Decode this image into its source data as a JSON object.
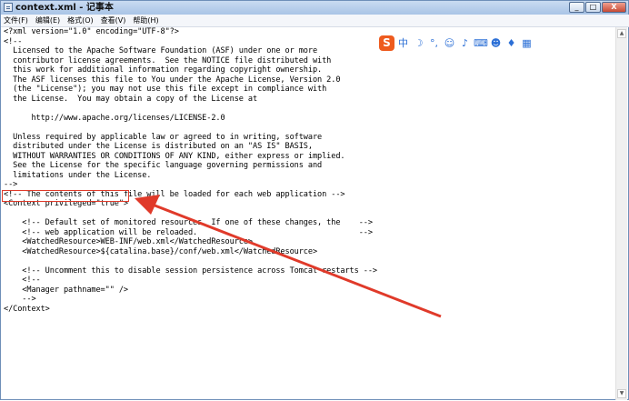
{
  "window": {
    "title": "context.xml - 记事本",
    "controls": {
      "minimize": "_",
      "maximize": "□",
      "close": "X"
    }
  },
  "menu": [
    "文件(F)",
    "编辑(E)",
    "格式(O)",
    "查看(V)",
    "帮助(H)"
  ],
  "editor": {
    "lines": [
      "<?xml version=\"1.0\" encoding=\"UTF-8\"?>",
      "<!--",
      "  Licensed to the Apache Software Foundation (ASF) under one or more",
      "  contributor license agreements.  See the NOTICE file distributed with",
      "  this work for additional information regarding copyright ownership.",
      "  The ASF licenses this file to You under the Apache License, Version 2.0",
      "  (the \"License\"); you may not use this file except in compliance with",
      "  the License.  You may obtain a copy of the License at",
      "",
      "      http://www.apache.org/licenses/LICENSE-2.0",
      "",
      "  Unless required by applicable law or agreed to in writing, software",
      "  distributed under the License is distributed on an \"AS IS\" BASIS,",
      "  WITHOUT WARRANTIES OR CONDITIONS OF ANY KIND, either express or implied.",
      "  See the License for the specific language governing permissions and",
      "  limitations under the License.",
      "-->",
      "<!-- The contents of this file will be loaded for each web application -->",
      "<Context privileged=\"true\">",
      "",
      "    <!-- Default set of monitored resources. If one of these changes, the    -->",
      "    <!-- web application will be reloaded.                                   -->",
      "    <WatchedResource>WEB-INF/web.xml</WatchedResource>",
      "    <WatchedResource>${catalina.base}/conf/web.xml</WatchedResource>",
      "",
      "    <!-- Uncomment this to disable session persistence across Tomcat restarts -->",
      "    <!--",
      "    <Manager pathname=\"\" />",
      "    -->",
      "</Context>"
    ]
  },
  "ime_toolbar": {
    "logo": "S",
    "mode": "中",
    "icons": [
      "moon-icon",
      "punctuation-icon",
      "emoji-icon",
      "microphone-icon",
      "keyboard-icon",
      "user-icon",
      "skin-icon",
      "grid-icon"
    ]
  },
  "annotation": {
    "color": "#e03a2a"
  },
  "colors": {
    "ime_brand": "#ee5b1e",
    "ime_icon": "#2b6fd6",
    "title_bar": "#a9c4e6"
  }
}
